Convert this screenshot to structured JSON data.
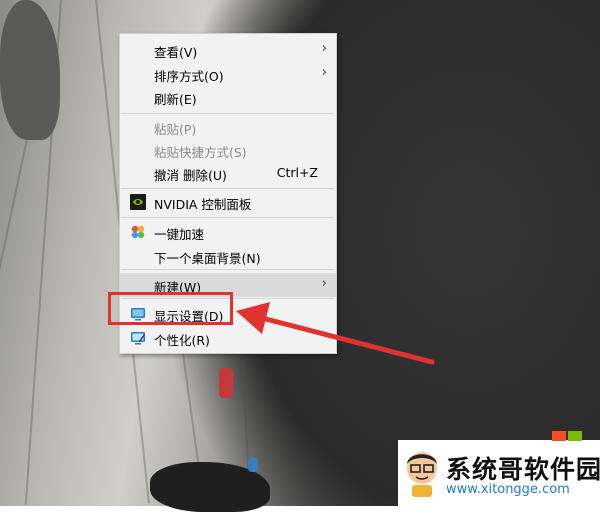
{
  "context_menu": {
    "items": [
      {
        "label": "查看(V)",
        "submenu": true,
        "disabled": false
      },
      {
        "label": "排序方式(O)",
        "submenu": true,
        "disabled": false
      },
      {
        "label": "刷新(E)",
        "submenu": false,
        "disabled": false
      },
      {
        "label": "粘贴(P)",
        "submenu": false,
        "disabled": true
      },
      {
        "label": "粘贴快捷方式(S)",
        "submenu": false,
        "disabled": true
      },
      {
        "label": "撤消 删除(U)",
        "shortcut": "Ctrl+Z",
        "disabled": false
      },
      {
        "label": "NVIDIA 控制面板",
        "icon": "nvidia-icon",
        "disabled": false
      },
      {
        "label": "一键加速",
        "icon": "speedup-icon",
        "disabled": false
      },
      {
        "label": "下一个桌面背景(N)",
        "disabled": false
      },
      {
        "label": "新建(W)",
        "submenu": true,
        "highlighted": true
      },
      {
        "label": "显示设置(D)",
        "icon": "display-icon",
        "disabled": false
      },
      {
        "label": "个性化(R)",
        "icon": "personalize-icon",
        "disabled": false
      }
    ]
  },
  "annotation": {
    "color": "#e0332f"
  },
  "watermark": {
    "title": "系统哥软件园",
    "url": "www.xitongge.com"
  }
}
